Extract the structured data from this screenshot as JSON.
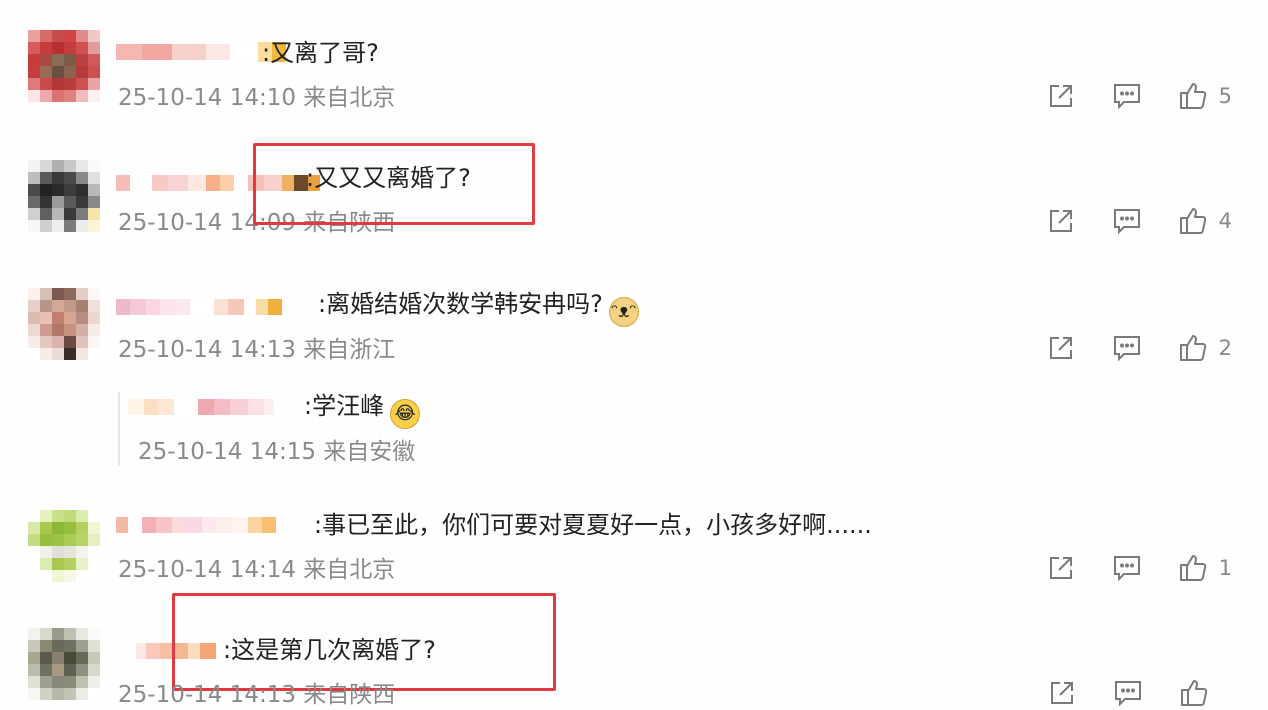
{
  "comments": [
    {
      "text": ":又离了哥?",
      "meta": "25-10-14 14:10 来自北京",
      "likes": "5"
    },
    {
      "text": ":又又又离婚了?",
      "meta": "25-10-14 14:09 来自陕西",
      "likes": "4"
    },
    {
      "text": ":离婚结婚次数学韩安冉吗?",
      "meta": "25-10-14 14:13 来自浙江",
      "likes": "2",
      "reply": {
        "text": ":学汪峰",
        "meta": "25-10-14 14:15 来自安徽"
      }
    },
    {
      "text": ":事已至此，你们可要对夏夏好一点，小孩多好啊......",
      "meta": "25-10-14 14:14 来自北京",
      "likes": "1"
    },
    {
      "text": ":这是第几次离婚了?",
      "meta": "25-10-14 14:13 来自陕西",
      "likes": ""
    }
  ],
  "icons": {
    "share": "share-icon",
    "comment": "comment-icon",
    "like": "thumbs-up-icon"
  },
  "colors": {
    "highlight": "#e0393e",
    "meta": "#8a8a8a"
  }
}
